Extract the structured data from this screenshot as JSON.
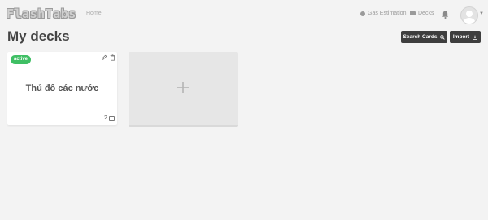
{
  "header": {
    "logo": "FlashTabs",
    "nav": {
      "home": "Home",
      "gas_estimation": "Gas Estimation",
      "decks": "Decks"
    },
    "icons": {
      "notifications": "bell-icon",
      "profile": "user-avatar-icon"
    }
  },
  "main": {
    "title": "My decks",
    "search_button": "Search Cards",
    "import_button": "Import"
  },
  "decks": [
    {
      "status": "active",
      "name": "Thủ đô các nước",
      "card_count": "2"
    }
  ],
  "colors": {
    "active_badge": "#3fbf64",
    "primary_button": "#3e3e3e"
  }
}
